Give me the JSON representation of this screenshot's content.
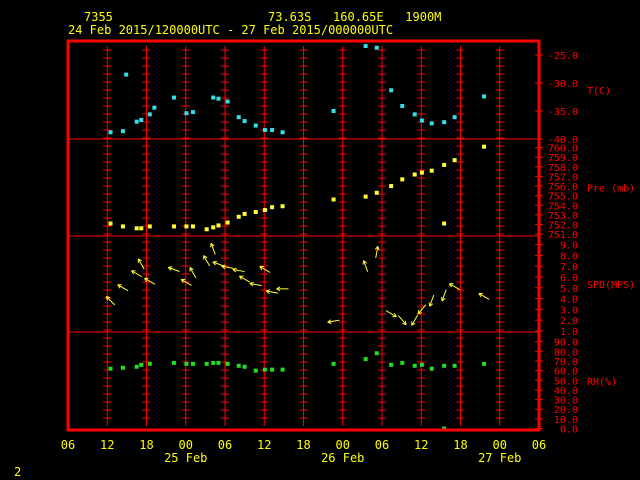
{
  "header": {
    "station_id": "7355",
    "location": "73.63S   160.65E   1900M",
    "period": "24 Feb 2015/120000UTC - 27 Feb 2015/000000UTC"
  },
  "footer": {
    "page_number": "2"
  },
  "colors": {
    "frame": "#ff0000",
    "temperature": "#33e0e6",
    "pressure": "#ffff33",
    "wind": "#ffff33",
    "humidity": "#22dd22",
    "label": "#ffff00"
  },
  "chart_data": {
    "type": "scatter",
    "x_axis": {
      "unit": "hours since 24 Feb 06UTC",
      "range": [
        0,
        72
      ],
      "tick_labels": [
        "06",
        "12",
        "18",
        "00",
        "06",
        "12",
        "18",
        "00",
        "06",
        "12",
        "18",
        "00",
        "06"
      ],
      "date_labels": [
        {
          "label": "25 Feb",
          "hour": 18
        },
        {
          "label": "26 Feb",
          "hour": 42
        },
        {
          "label": "27 Feb",
          "hour": 66
        }
      ]
    },
    "panels": [
      {
        "name": "temperature",
        "label": "T(C)",
        "range": [
          -40,
          -22.5
        ],
        "tick_labels": [
          "-40.0",
          "-35.0",
          "-30.0",
          "-25.0"
        ],
        "tick_values": [
          -40,
          -35,
          -30,
          -25
        ],
        "points": [
          [
            6.5,
            -38.8
          ],
          [
            8.4,
            -38.6
          ],
          [
            8.9,
            -28.5
          ],
          [
            10.5,
            -36.9
          ],
          [
            11.2,
            -36.6
          ],
          [
            12.5,
            -35.6
          ],
          [
            13.2,
            -34.4
          ],
          [
            16.2,
            -32.6
          ],
          [
            18.1,
            -35.4
          ],
          [
            19.1,
            -35.2
          ],
          [
            22.2,
            -32.6
          ],
          [
            23.0,
            -32.8
          ],
          [
            24.4,
            -33.3
          ],
          [
            26.1,
            -36.1
          ],
          [
            27.0,
            -36.8
          ],
          [
            28.7,
            -37.6
          ],
          [
            30.1,
            -38.4
          ],
          [
            31.2,
            -38.4
          ],
          [
            32.8,
            -38.8
          ],
          [
            40.6,
            -35.0
          ],
          [
            45.5,
            -23.4
          ],
          [
            47.2,
            -23.7
          ],
          [
            49.4,
            -31.3
          ],
          [
            51.1,
            -34.1
          ],
          [
            53.0,
            -35.6
          ],
          [
            54.1,
            -36.7
          ],
          [
            55.6,
            -37.2
          ],
          [
            57.5,
            -37.0
          ],
          [
            59.1,
            -36.1
          ],
          [
            63.6,
            -32.4
          ]
        ]
      },
      {
        "name": "pressure",
        "label": "Pre (mb)",
        "range": [
          750.8,
          760.9
        ],
        "tick_labels": [
          "751.0",
          "752.0",
          "753.0",
          "754.0",
          "755.0",
          "756.0",
          "757.0",
          "758.0",
          "759.0",
          "760.0"
        ],
        "tick_values": [
          751,
          752,
          753,
          754,
          755,
          756,
          757,
          758,
          759,
          760
        ],
        "points": [
          [
            6.5,
            752.1
          ],
          [
            8.4,
            751.8
          ],
          [
            10.5,
            751.6
          ],
          [
            11.2,
            751.6
          ],
          [
            12.5,
            751.8
          ],
          [
            16.2,
            751.8
          ],
          [
            18.1,
            751.8
          ],
          [
            19.1,
            751.8
          ],
          [
            21.2,
            751.5
          ],
          [
            22.2,
            751.7
          ],
          [
            23.0,
            751.9
          ],
          [
            24.4,
            752.2
          ],
          [
            26.1,
            752.8
          ],
          [
            27.0,
            753.1
          ],
          [
            28.7,
            753.3
          ],
          [
            30.1,
            753.5
          ],
          [
            31.2,
            753.8
          ],
          [
            32.8,
            753.9
          ],
          [
            40.6,
            754.6
          ],
          [
            45.5,
            754.9
          ],
          [
            47.2,
            755.3
          ],
          [
            49.4,
            756.0
          ],
          [
            51.1,
            756.7
          ],
          [
            53.0,
            757.2
          ],
          [
            54.1,
            757.4
          ],
          [
            55.6,
            757.6
          ],
          [
            57.5,
            758.2
          ],
          [
            57.5,
            752.1
          ],
          [
            59.1,
            758.7
          ],
          [
            63.6,
            760.1
          ]
        ]
      },
      {
        "name": "wind",
        "label": "SPD(MPS)",
        "range": [
          0.9,
          9.8
        ],
        "tick_labels": [
          "1.0",
          "2.0",
          "3.0",
          "4.0",
          "5.0",
          "6.0",
          "7.0",
          "8.0",
          "9.0"
        ],
        "tick_values": [
          1,
          2,
          3,
          4,
          5,
          6,
          7,
          8,
          9
        ],
        "vectors": [
          [
            6.5,
            3.8,
            135
          ],
          [
            8.4,
            5.0,
            120
          ],
          [
            10.5,
            6.3,
            120
          ],
          [
            11.2,
            7.2,
            150
          ],
          [
            12.5,
            5.6,
            120
          ],
          [
            16.2,
            6.7,
            110
          ],
          [
            18.1,
            5.5,
            120
          ],
          [
            19.1,
            6.4,
            150
          ],
          [
            21.2,
            7.5,
            150
          ],
          [
            22.2,
            8.6,
            160
          ],
          [
            23.0,
            7.2,
            110
          ],
          [
            24.4,
            6.9,
            100
          ],
          [
            26.1,
            6.6,
            100
          ],
          [
            27.0,
            5.8,
            120
          ],
          [
            28.7,
            5.3,
            100
          ],
          [
            30.1,
            6.7,
            120
          ],
          [
            31.2,
            4.6,
            100
          ],
          [
            32.8,
            4.9,
            90
          ],
          [
            40.6,
            1.9,
            80
          ],
          [
            45.5,
            7.0,
            160
          ],
          [
            47.2,
            8.3,
            190
          ],
          [
            49.4,
            2.6,
            300
          ],
          [
            51.1,
            2.0,
            320
          ],
          [
            53.0,
            2.0,
            30
          ],
          [
            54.1,
            3.0,
            40
          ],
          [
            55.6,
            3.8,
            20
          ],
          [
            57.5,
            4.3,
            20
          ],
          [
            59.1,
            5.1,
            120
          ],
          [
            63.6,
            4.2,
            120
          ]
        ]
      },
      {
        "name": "humidity",
        "label": "RH(%)",
        "range": [
          -1.5,
          100
        ],
        "tick_labels": [
          "0.0",
          "10.0",
          "20.0",
          "30.0",
          "40.0",
          "50.0",
          "60.0",
          "70.0",
          "80.0",
          "90.0"
        ],
        "tick_values": [
          0,
          10,
          20,
          30,
          40,
          50,
          60,
          70,
          80,
          90
        ],
        "points": [
          [
            6.5,
            62
          ],
          [
            8.4,
            63
          ],
          [
            10.5,
            64
          ],
          [
            11.2,
            66
          ],
          [
            12.5,
            67
          ],
          [
            16.2,
            68
          ],
          [
            18.1,
            67
          ],
          [
            19.1,
            67
          ],
          [
            21.2,
            67
          ],
          [
            22.2,
            68
          ],
          [
            23.0,
            68
          ],
          [
            24.4,
            67
          ],
          [
            26.1,
            65
          ],
          [
            27.0,
            64
          ],
          [
            28.7,
            60
          ],
          [
            30.1,
            61
          ],
          [
            31.2,
            61
          ],
          [
            32.8,
            61
          ],
          [
            40.6,
            67
          ],
          [
            45.5,
            72
          ],
          [
            47.2,
            78
          ],
          [
            49.4,
            66
          ],
          [
            51.1,
            68
          ],
          [
            53.0,
            65
          ],
          [
            54.1,
            66
          ],
          [
            55.6,
            62
          ],
          [
            57.5,
            65
          ],
          [
            57.5,
            0
          ],
          [
            59.1,
            65
          ],
          [
            63.6,
            67
          ]
        ]
      }
    ]
  }
}
